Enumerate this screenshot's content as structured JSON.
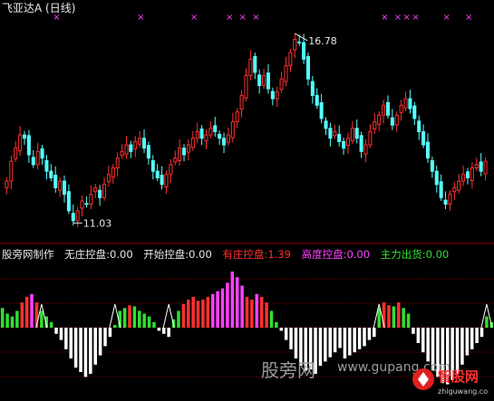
{
  "window": {
    "title": "飞亚达A",
    "period": "(日线)"
  },
  "price_annotations": {
    "high_label": "16.78",
    "low_label": "11.03",
    "cross_marker": "×"
  },
  "indicator_bar": {
    "source": "股旁网制作",
    "items": [
      {
        "label": "无庄控盘:",
        "value": "0.00",
        "color": "#e8e8e8"
      },
      {
        "label": "开始控盘:",
        "value": "0.00",
        "color": "#e8e8e8"
      },
      {
        "label": "有庄控盘:",
        "value": "1.39",
        "color": "#ff3030"
      },
      {
        "label": "高度控盘:",
        "value": "0.00",
        "color": "#ff40ff"
      },
      {
        "label": "主力出货:",
        "value": "0.00",
        "color": "#30e030"
      }
    ]
  },
  "watermarks": {
    "site_cn": "股旁网",
    "site_url": "www.gupang.com",
    "logo_text": "智股网",
    "logo_url": "zhiguwang.com"
  },
  "colors": {
    "up": "#ff3030",
    "down": "#54ffff",
    "magenta": "#ff40ff",
    "green": "#30e030",
    "white": "#ffffff",
    "grid": "#8b0000"
  },
  "chart_data": [
    {
      "type": "candlestick",
      "title": "飞亚达A (日线)",
      "ylim": [
        10.6,
        17.3
      ],
      "annotations": [
        {
          "label": "16.78",
          "value": 16.78
        },
        {
          "label": "11.03",
          "value": 11.03
        }
      ],
      "close": [
        12.3,
        12.9,
        13.3,
        13.7,
        13.6,
        13.1,
        12.8,
        13.2,
        13.0,
        12.6,
        12.4,
        12.1,
        12.3,
        11.9,
        11.4,
        11.1,
        11.4,
        11.7,
        11.6,
        11.9,
        12.1,
        11.8,
        12.2,
        12.5,
        12.7,
        13.0,
        13.2,
        13.4,
        13.2,
        13.5,
        13.6,
        13.3,
        13.0,
        12.6,
        12.4,
        12.2,
        12.5,
        12.8,
        13.0,
        13.3,
        13.1,
        13.4,
        13.6,
        13.8,
        13.6,
        13.7,
        13.9,
        13.8,
        13.6,
        13.4,
        13.7,
        14.1,
        14.4,
        14.9,
        15.5,
        16.0,
        15.6,
        15.2,
        15.5,
        15.1,
        14.8,
        15.0,
        15.4,
        15.8,
        16.2,
        16.6,
        16.5,
        16.0,
        15.4,
        14.9,
        14.6,
        14.2,
        13.9,
        13.6,
        13.8,
        13.5,
        13.3,
        13.6,
        13.9,
        13.6,
        13.2,
        13.4,
        13.8,
        14.1,
        14.3,
        14.6,
        14.3,
        14.0,
        14.3,
        14.6,
        14.8,
        14.5,
        14.2,
        13.8,
        13.4,
        13.0,
        12.6,
        12.2,
        11.8,
        11.6,
        11.9,
        12.1,
        12.3,
        12.5,
        12.4,
        12.7,
        12.8,
        12.6,
        12.9
      ],
      "markers_x": [
        11,
        30,
        42,
        50,
        53,
        56,
        85,
        88,
        90,
        92,
        99,
        104,
        113,
        116,
        119,
        126
      ],
      "hidden": true
    },
    {
      "type": "bar",
      "title": "",
      "ylim": [
        -1,
        1
      ],
      "series": [
        {
          "values": [
            0.35,
            0.25,
            0.2,
            0.3,
            0.45,
            0.55,
            0.6,
            0.45,
            0.3,
            0.2,
            0.1,
            -0.1,
            -0.2,
            -0.35,
            -0.5,
            -0.65,
            -0.72,
            -0.8,
            -0.75,
            -0.6,
            -0.45,
            -0.3,
            -0.15,
            0.05,
            0.3,
            0.35,
            0.4,
            0.38,
            0.3,
            0.25,
            0.2,
            0.1,
            -0.05,
            -0.1,
            -0.15,
            0.15,
            0.3,
            0.42,
            0.5,
            0.55,
            0.48,
            0.5,
            0.55,
            0.6,
            0.65,
            0.7,
            0.8,
            1.0,
            0.9,
            0.75,
            0.55,
            0.5,
            0.6,
            0.55,
            0.45,
            0.3,
            0.1,
            -0.05,
            -0.2,
            -0.35,
            -0.5,
            -0.62,
            -0.7,
            -0.68,
            -0.75,
            -0.62,
            -0.55,
            -0.48,
            -0.4,
            -0.33,
            -0.5,
            -0.45,
            -0.4,
            -0.35,
            -0.3,
            -0.2,
            -0.15,
            0.35,
            0.45,
            0.4,
            0.38,
            0.45,
            0.35,
            0.25,
            -0.1,
            -0.25,
            -0.4,
            -0.55,
            -0.7,
            -0.8,
            -0.9,
            -0.92,
            -0.85,
            -0.75,
            -0.6,
            -0.45,
            -0.35,
            -0.25,
            -0.15,
            0.2,
            0.1
          ]
        }
      ]
    }
  ]
}
